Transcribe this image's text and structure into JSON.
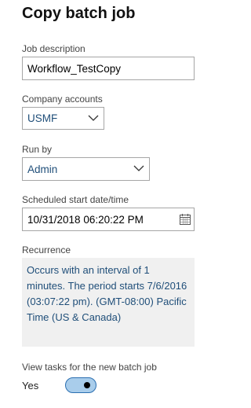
{
  "title": "Copy batch job",
  "job_description": {
    "label": "Job description",
    "value": "Workflow_TestCopy"
  },
  "company_accounts": {
    "label": "Company accounts",
    "value": "USMF",
    "icon": "chevron-down-icon"
  },
  "run_by": {
    "label": "Run by",
    "value": "Admin",
    "icon": "chevron-down-icon"
  },
  "scheduled_start": {
    "label": "Scheduled start date/time",
    "value": "10/31/2018 06:20:22 PM",
    "icon": "calendar-icon"
  },
  "recurrence": {
    "label": "Recurrence",
    "text": "Occurs with an interval of 1 minutes. The period starts 7/6/2016 (03:07:22 pm). (GMT-08:00) Pacific Time (US & Canada)"
  },
  "view_tasks": {
    "label": "View tasks for the new batch job",
    "state_label": "Yes",
    "on": true
  },
  "colors": {
    "link_text": "#1f4e79",
    "toggle_fill": "#a9cdeb",
    "toggle_border": "#2b6fb1",
    "recurrence_bg": "#f0f0f0"
  }
}
